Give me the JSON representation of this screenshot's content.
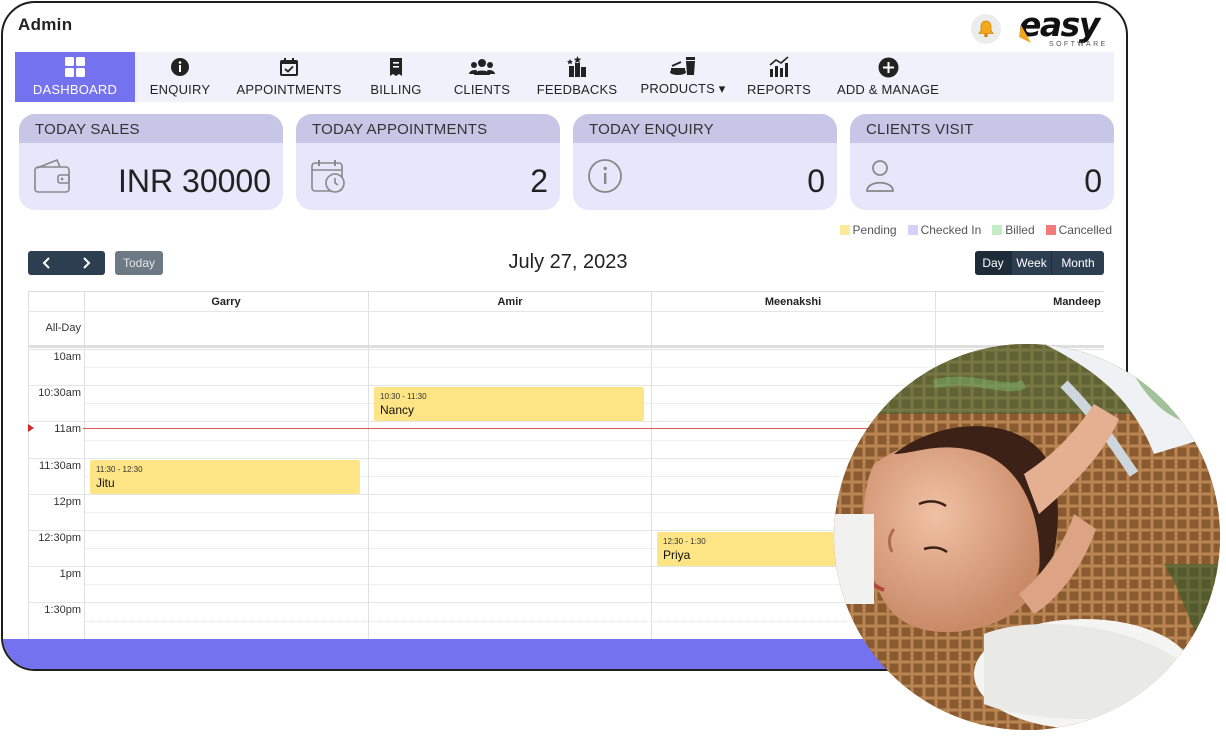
{
  "app": {
    "title": "Admin",
    "logo_word": "easy",
    "logo_sub": "SOFTWARE"
  },
  "nav": [
    {
      "label": "DASHBOARD",
      "icon": "dashboard-icon",
      "active": true
    },
    {
      "label": "ENQUIRY",
      "icon": "info-icon"
    },
    {
      "label": "APPOINTMENTS",
      "icon": "calendar-icon"
    },
    {
      "label": "BILLING",
      "icon": "receipt-icon"
    },
    {
      "label": "CLIENTS",
      "icon": "users-icon"
    },
    {
      "label": "FEEDBACKS",
      "icon": "feedback-icon"
    },
    {
      "label": "PRODUCTS ▾",
      "icon": "products-icon"
    },
    {
      "label": "REPORTS",
      "icon": "chart-icon"
    },
    {
      "label": "ADD & MANAGE",
      "icon": "plus-circle-icon"
    }
  ],
  "cards": [
    {
      "title": "TODAY SALES",
      "value": "INR 30000",
      "icon": "wallet-icon"
    },
    {
      "title": "TODAY APPOINTMENTS",
      "value": "2",
      "icon": "calendar-clock-icon"
    },
    {
      "title": "TODAY ENQUIRY",
      "value": "0",
      "icon": "info-circle-icon"
    },
    {
      "title": "CLIENTS VISIT",
      "value": "0",
      "icon": "user-icon"
    }
  ],
  "legend": [
    {
      "label": "Pending",
      "color": "#fde99a"
    },
    {
      "label": "Checked In",
      "color": "#d6d2f7"
    },
    {
      "label": "Billed",
      "color": "#c5ecc4"
    },
    {
      "label": "Cancelled",
      "color": "#f27a78"
    }
  ],
  "calendar": {
    "today_label": "Today",
    "date": "July 27, 2023",
    "views": [
      "Day",
      "Week",
      "Month"
    ],
    "active_view": "Day",
    "allday_label": "All-Day",
    "staff": [
      "Garry",
      "Amir",
      "Meenakshi",
      "Mandeep"
    ],
    "times": [
      "10am",
      "10:30am",
      "11am",
      "11:30am",
      "12pm",
      "12:30pm",
      "1pm",
      "1:30pm"
    ],
    "events": [
      {
        "staff": "Amir",
        "time": "10:30 - 11:30",
        "name": "Nancy",
        "status": "Pending"
      },
      {
        "staff": "Garry",
        "time": "11:30 - 12:30",
        "name": "Jitu",
        "status": "Pending"
      },
      {
        "staff": "Meenakshi",
        "time": "12:30 - 1:30",
        "name": "Priya",
        "status": "Pending"
      }
    ]
  }
}
